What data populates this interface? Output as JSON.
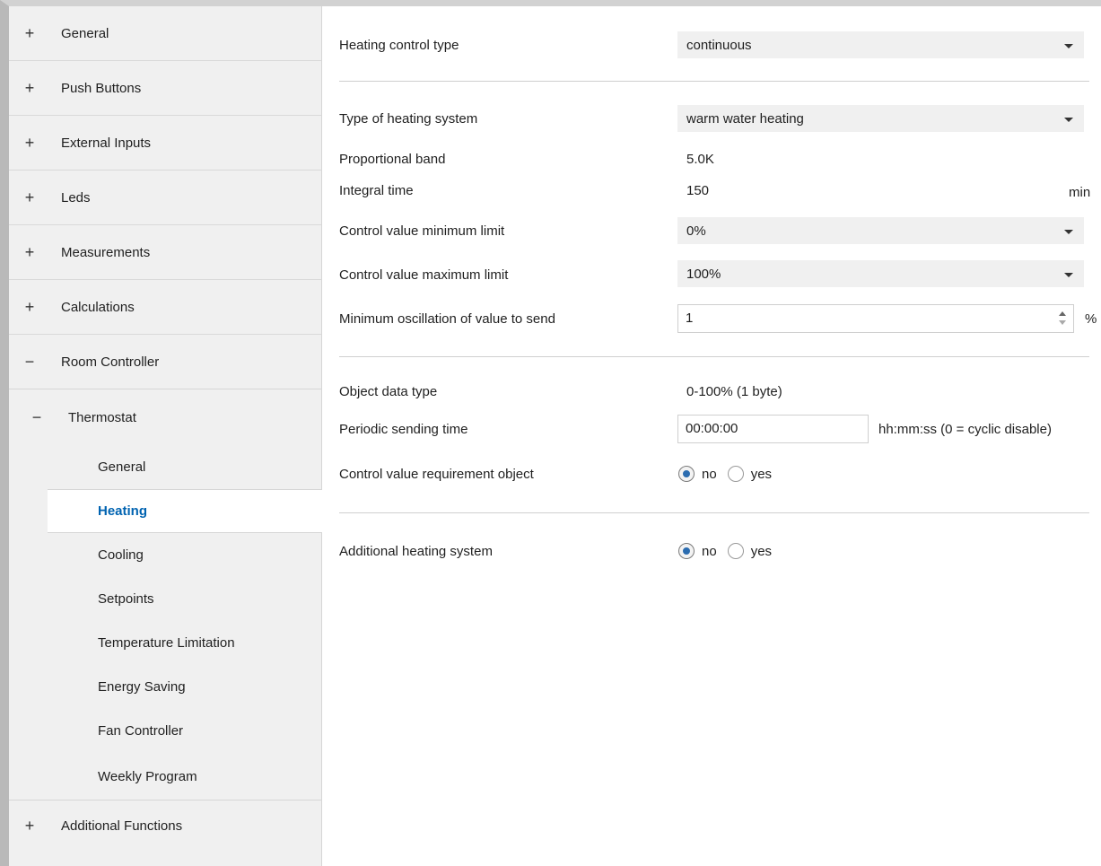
{
  "sidebar": {
    "top_items": [
      {
        "label": "General",
        "expander": "+"
      },
      {
        "label": "Push Buttons",
        "expander": "+"
      },
      {
        "label": "External Inputs",
        "expander": "+"
      },
      {
        "label": "Leds",
        "expander": "+"
      },
      {
        "label": "Measurements",
        "expander": "+"
      },
      {
        "label": "Calculations",
        "expander": "+"
      },
      {
        "label": "Room Controller",
        "expander": "−"
      }
    ],
    "sub_group": {
      "label": "Thermostat",
      "expander": "−"
    },
    "leaves": [
      {
        "label": "General"
      },
      {
        "label": "Heating"
      },
      {
        "label": "Cooling"
      },
      {
        "label": "Setpoints"
      },
      {
        "label": "Temperature Limitation"
      },
      {
        "label": "Energy Saving"
      },
      {
        "label": "Fan Controller"
      },
      {
        "label": "Weekly Program"
      }
    ],
    "bottom_item": {
      "label": "Additional Functions",
      "expander": "+"
    }
  },
  "main": {
    "heating_control_type": {
      "label": "Heating control type",
      "value": "continuous"
    },
    "type_of_heating_system": {
      "label": "Type of heating system",
      "value": "warm water heating"
    },
    "proportional_band": {
      "label": "Proportional band",
      "value": "5.0K"
    },
    "integral_time": {
      "label": "Integral time",
      "value": "150",
      "unit": "min"
    },
    "min_limit": {
      "label": "Control value minimum limit",
      "value": "0%"
    },
    "max_limit": {
      "label": "Control value maximum limit",
      "value": "100%"
    },
    "min_oscillation": {
      "label": "Minimum oscillation of value to send",
      "value": "1",
      "unit": "%"
    },
    "object_data_type": {
      "label": "Object data type",
      "value": "0-100% (1 byte)"
    },
    "periodic_sending": {
      "label": "Periodic sending time",
      "value": "00:00:00",
      "hint": "hh:mm:ss (0 = cyclic disable)"
    },
    "requirement_object": {
      "label": "Control value requirement object",
      "options": [
        "no",
        "yes"
      ],
      "selected": "no"
    },
    "additional_heating": {
      "label": "Additional heating system",
      "options": [
        "no",
        "yes"
      ],
      "selected": "no"
    }
  }
}
